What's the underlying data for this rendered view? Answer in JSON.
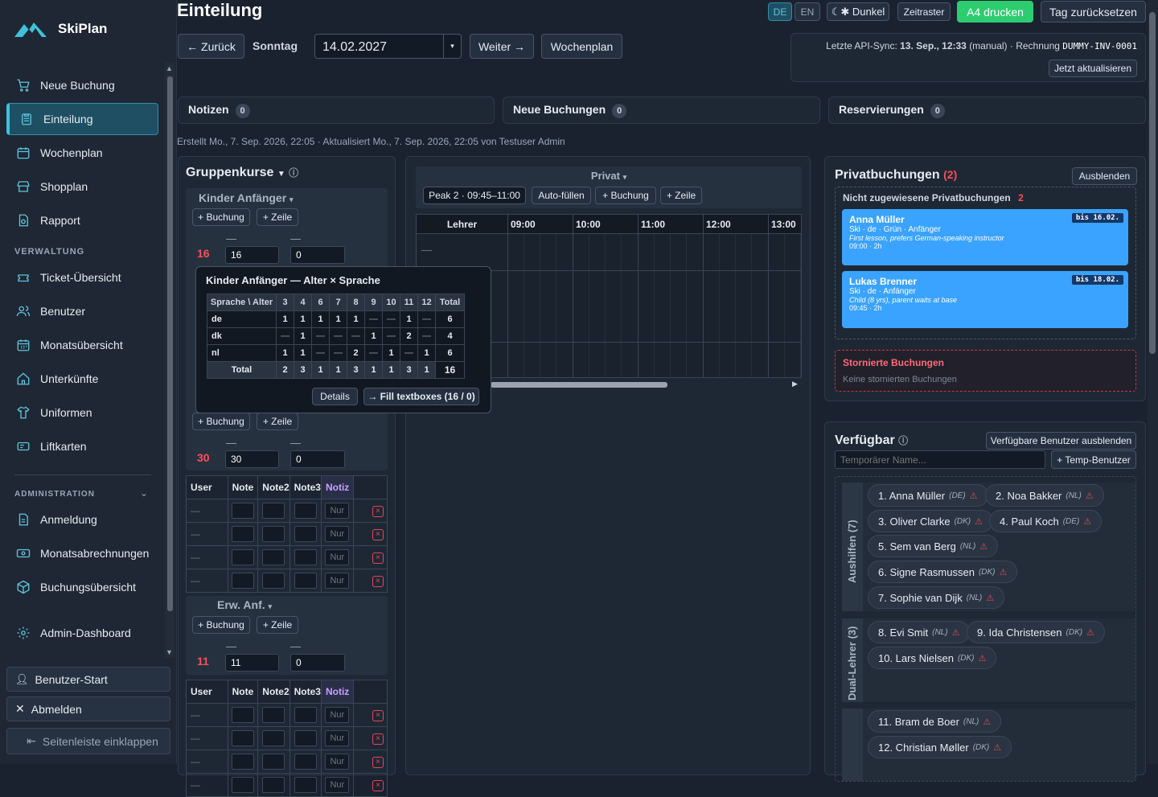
{
  "app": {
    "name": "SkiPlan"
  },
  "nav": {
    "items": [
      "Neue Buchung",
      "Einteilung",
      "Wochenplan",
      "Shopplan",
      "Rapport"
    ],
    "section_verwaltung": "VERWALTUNG",
    "verwaltung": [
      "Ticket-Übersicht",
      "Benutzer",
      "Monatsübersicht",
      "Unterkünfte",
      "Uniformen",
      "Liftkarten"
    ],
    "section_admin": "ADMINISTRATION",
    "admin": [
      "Anmeldung",
      "Monatsabrechnungen",
      "Buchungsübersicht"
    ],
    "admin_dashboard": "Admin-Dashboard",
    "user_start": "Benutzer-Start",
    "logout": "Abmelden",
    "collapse": "Seitenleiste einklappen"
  },
  "header": {
    "title": "Einteilung",
    "lang_de": "DE",
    "lang_en": "EN",
    "dark": "☾✱ Dunkel",
    "zeitraster": "Zeitraster",
    "print": "A4 drucken",
    "reset": "Tag zurücksetzen",
    "back": "← Zurück",
    "weekday": "Sonntag",
    "date": "14.02.2027",
    "next": "Weiter →",
    "weekplan": "Wochenplan",
    "sync_label": "Letzte API-Sync:",
    "sync_date": "13. Sep., 12:33",
    "sync_mode": "(manual)",
    "invoice_label": "Rechnung",
    "invoice": "DUMMY-INV-0001",
    "refresh": "Jetzt aktualisieren"
  },
  "tabs": {
    "notes": "Notizen",
    "notes_count": "0",
    "new_bookings": "Neue Buchungen",
    "new_count": "0",
    "reservations": "Reservierungen",
    "res_count": "0"
  },
  "meta": "Erstellt Mo., 7. Sep. 2026, 22:05 · Aktualisiert Mo., 7. Sep. 2026, 22:05 von Testuser Admin",
  "groups": {
    "title": "Gruppenkurse",
    "add_booking": "+ Buchung",
    "add_row": "+ Zeile",
    "g1": {
      "name": "Kinder Anfänger",
      "count": "16",
      "val1": "16",
      "val2": "0"
    },
    "g2": {
      "count": "30",
      "val1": "30",
      "val2": "0"
    },
    "g3": {
      "name": "Erw. Anf.",
      "count": "11",
      "val1": "11",
      "val2": "0"
    },
    "cols": [
      "User",
      "Note",
      "Note2",
      "Note3",
      "Notiz"
    ],
    "placeholder": "Nur",
    "dash": "—"
  },
  "popover": {
    "title": "Kinder Anfänger — Alter × Sprache",
    "corner": "Sprache \\ Alter",
    "ages": [
      "3",
      "4",
      "6",
      "7",
      "8",
      "9",
      "10",
      "11",
      "12",
      "Total"
    ],
    "rows": [
      {
        "lang": "de",
        "vals": [
          "1",
          "1",
          "1",
          "1",
          "1",
          "—",
          "—",
          "1",
          "—",
          "6"
        ]
      },
      {
        "lang": "dk",
        "vals": [
          "—",
          "1",
          "—",
          "—",
          "—",
          "1",
          "—",
          "2",
          "—",
          "4"
        ]
      },
      {
        "lang": "nl",
        "vals": [
          "1",
          "1",
          "—",
          "—",
          "2",
          "—",
          "1",
          "—",
          "1",
          "6"
        ]
      }
    ],
    "total_label": "Total",
    "totals": [
      "2",
      "3",
      "1",
      "1",
      "3",
      "1",
      "1",
      "3",
      "1",
      "16"
    ],
    "details": "Details",
    "fill": "→ Fill textboxes (16 / 0)"
  },
  "privat": {
    "title": "Privat",
    "peak": "Peak 2 · 09:45–11:00",
    "autofill": "Auto-füllen",
    "add_booking": "+ Buchung",
    "add_row": "+ Zeile",
    "col_teacher": "Lehrer",
    "hours": [
      "09:00",
      "10:00",
      "11:00",
      "12:00",
      "13:00"
    ],
    "dash": "—"
  },
  "private_bookings": {
    "title": "Privatbuchungen",
    "count": "(2)",
    "hide": "Ausblenden",
    "unassigned": "Nicht zugewiesene Privatbuchungen",
    "unassigned_count": "2",
    "cards": [
      {
        "name": "Anna Müller",
        "sub": "Ski · de · Grün · Anfänger",
        "note": "First lesson, prefers German-speaking instructor",
        "time": "09:00 · 2h",
        "due": "bis 16.02."
      },
      {
        "name": "Lukas Brenner",
        "sub": "Ski · de · Anfänger",
        "note": "Child (8 yrs), parent waits at base",
        "time": "09:45 · 2h",
        "due": "bis 18.02."
      }
    ],
    "cancelled": "Stornierte Buchungen",
    "cancelled_none": "Keine stornierten Buchungen"
  },
  "available": {
    "title": "Verfügbar",
    "hide": "Verfügbare Benutzer ausblenden",
    "temp_placeholder": "Temporärer Name...",
    "temp_btn": "+ Temp-Benutzer",
    "group1": "Aushilfen (7)",
    "group2": "Dual-Lehrer (3)",
    "people": [
      [
        "1. Anna Müller",
        "(DE)"
      ],
      [
        "2. Noa Bakker",
        "(NL)"
      ],
      [
        "3. Oliver Clarke",
        "(DK)"
      ],
      [
        "4. Paul Koch",
        "(DE)"
      ],
      [
        "5. Sem van Berg",
        "(NL)"
      ],
      [
        "6. Signe Rasmussen",
        "(DK)"
      ],
      [
        "7. Sophie van Dijk",
        "(NL)"
      ],
      [
        "8. Evi Smit",
        "(NL)"
      ],
      [
        "9. Ida Christensen",
        "(DK)"
      ],
      [
        "10. Lars Nielsen",
        "(DK)"
      ],
      [
        "11. Bram de Boer",
        "(NL)"
      ],
      [
        "12. Christian Møller",
        "(DK)"
      ]
    ],
    "warn": "⚠"
  },
  "colors": {
    "accent": "#3fc1d9",
    "print": "#2ecc71",
    "red": "#ff4d5a",
    "card": "#3aa3ff"
  }
}
